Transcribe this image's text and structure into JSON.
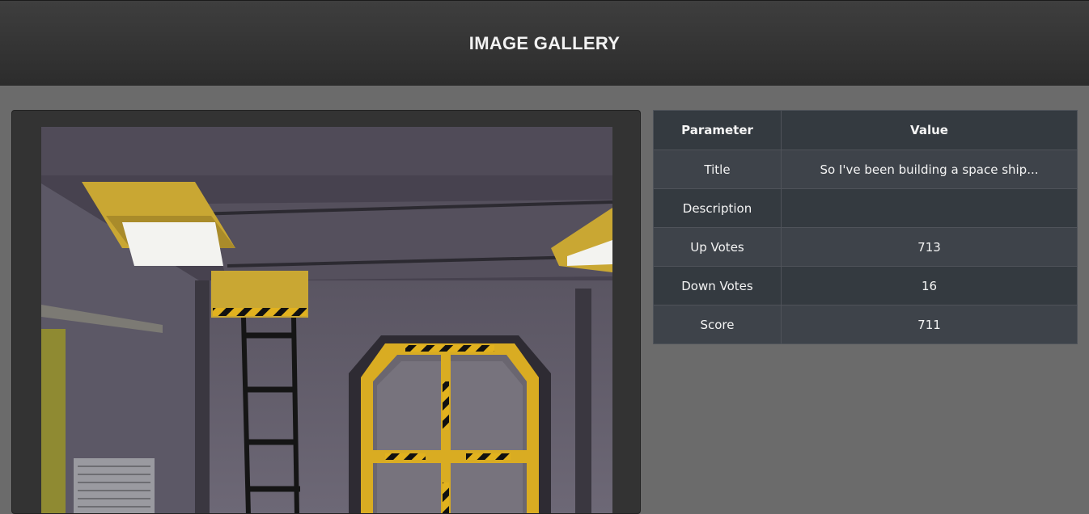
{
  "header": {
    "title": "IMAGE GALLERY"
  },
  "table": {
    "headers": [
      "Parameter",
      "Value"
    ],
    "rows": [
      {
        "parameter": "Title",
        "value": "So I've been building a space ship..."
      },
      {
        "parameter": "Description",
        "value": ""
      },
      {
        "parameter": "Up Votes",
        "value": "713"
      },
      {
        "parameter": "Down Votes",
        "value": "16"
      },
      {
        "parameter": "Score",
        "value": "711"
      }
    ]
  },
  "colors": {
    "page_bg": "#6b6b6b",
    "header_bg": "#333333",
    "table_header_bg": "#343a40",
    "table_row_bg": "#3e434a",
    "hazard_yellow": "#e8b520"
  }
}
